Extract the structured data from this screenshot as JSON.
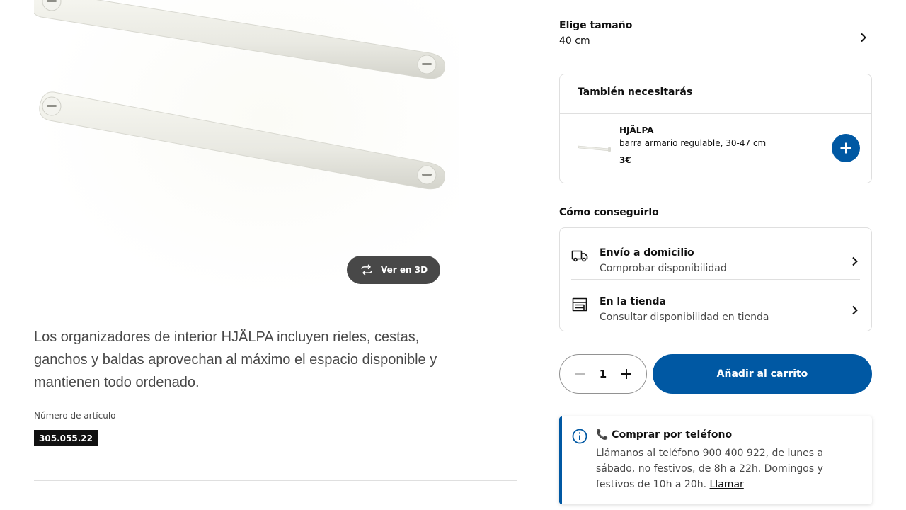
{
  "gallery": {
    "view3d_label": "Ver en 3D"
  },
  "product": {
    "description": "Los organizadores de interior HJÄLPA incluyen rieles, cestas, ganchos y baldas aprovechan al máximo el espacio disponible y mantienen todo ordenado.",
    "article_label": "Número de artículo",
    "article_number": "305.055.22"
  },
  "size": {
    "title": "Elige tamaño",
    "value": "40 cm"
  },
  "also_need": {
    "title": "También necesitarás",
    "item": {
      "name": "HJÄLPA",
      "description": "barra armario regulable, 30-47 cm",
      "price": "3€"
    }
  },
  "get_it": {
    "title": "Cómo conseguirlo",
    "options": [
      {
        "title": "Envío a domicilio",
        "subtitle": "Comprobar disponibilidad",
        "icon": "truck-icon"
      },
      {
        "title": "En la tienda",
        "subtitle": "Consultar disponibilidad en tienda",
        "icon": "store-icon"
      }
    ]
  },
  "purchase": {
    "quantity": "1",
    "add_to_cart": "Añadir al carrito"
  },
  "phone": {
    "title": "📞 Comprar por teléfono",
    "text": "Llámanos al teléfono 900 400 922, de lunes a sábado, no festivos, de 8h a 22h. Domingos y festivos de 10h a 20h.",
    "link": "Llamar"
  },
  "colors": {
    "primary": "#0058a3",
    "dark_button": "#484848",
    "divider": "#dfdfdf"
  }
}
